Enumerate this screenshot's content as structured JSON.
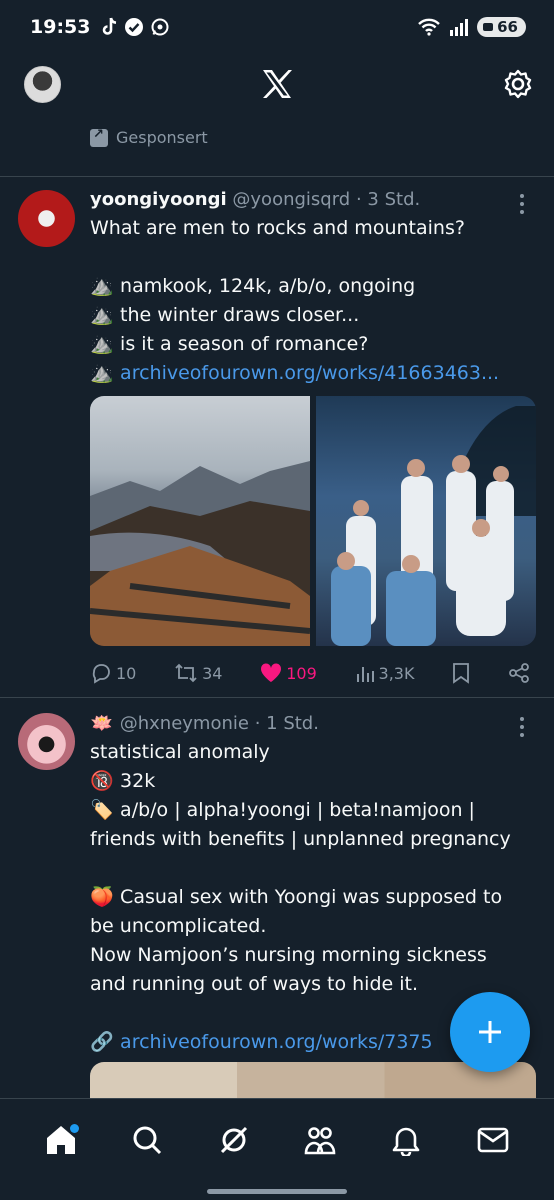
{
  "status_bar": {
    "time": "19:53",
    "battery": "66",
    "icons": [
      "tiktok-icon",
      "check-icon",
      "whatsapp-icon",
      "wifi-icon",
      "signal-icon"
    ]
  },
  "header": {
    "logo": "X",
    "icons": [
      "avatar",
      "x-logo-icon",
      "gear-icon"
    ]
  },
  "sponsored_label": "Gesponsert",
  "tweets": [
    {
      "name": "yoongiyoongi",
      "handle": "@yoongisqrd",
      "time": "· 3 Std.",
      "lines": [
        "What are men to rocks and mountains?",
        "",
        "namkook, 124k, a/b/o, ongoing",
        "the winter draws closer...",
        "is it a season of romance?"
      ],
      "line_emoji": "⛰️",
      "link": "archiveofourown.org/works/41663463...",
      "stats": {
        "replies": "10",
        "reposts": "34",
        "likes": "109",
        "views": "3,3K"
      }
    },
    {
      "name_emoji": "🪷",
      "handle": "@hxneymonie",
      "time": "· 1 Std.",
      "lines": [
        "statistical anomaly",
        "32k",
        "a/b/o | alpha!yoongi | beta!namjoon |",
        "friends with benefits | unplanned pregnancy",
        "",
        "Casual sex with Yoongi was supposed to",
        "be uncomplicated.",
        "Now Namjoon’s nursing morning sickness",
        "and running out of ways to hide it.",
        ""
      ],
      "emojis": {
        "rating": "🔞",
        "tags": "🏷️",
        "summary": "🍑",
        "link": "🔗"
      },
      "link": "archiveofourown.org/works/7375"
    }
  ],
  "bottom_nav": [
    "home-icon",
    "search-icon",
    "grok-icon",
    "communities-icon",
    "notifications-icon",
    "messages-icon"
  ],
  "colors": {
    "background": "#15202b",
    "accent": "#1d9bf0",
    "like": "#f91880",
    "muted": "#8b98a5",
    "link": "#4a99e9"
  }
}
